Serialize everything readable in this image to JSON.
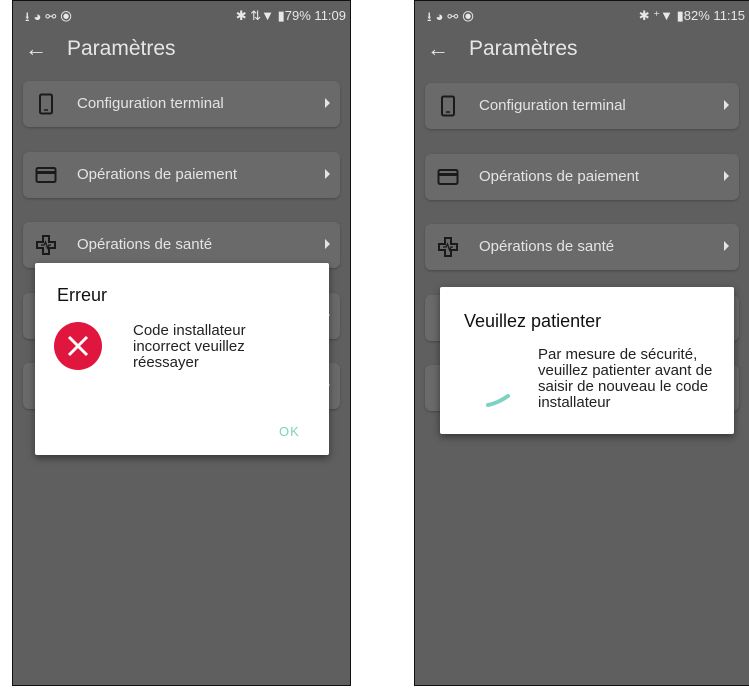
{
  "screens": [
    {
      "status": {
        "left_icons": "⭳◕⚯⦿",
        "right": "✱ ⇅▼ ▮79% 11:09"
      },
      "appbar": {
        "title": "Paramètres"
      },
      "menu": [
        {
          "label": "Configuration terminal",
          "icon": "phone-icon"
        },
        {
          "label": "Opérations de paiement",
          "icon": "card-icon"
        },
        {
          "label": "Opérations de santé",
          "icon": "health-cross-icon"
        }
      ],
      "dialog": {
        "title": "Erreur",
        "message": "Code installateur incorrect veuillez réessayer",
        "button": "OK",
        "icon": "error-x-icon",
        "icon_color": "#e0163e",
        "button_color": "#7dd3c0"
      }
    },
    {
      "status": {
        "left_icons": "⭳◕⚯⦿",
        "right": "✱ ⁺▼ ▮82% 11:15"
      },
      "appbar": {
        "title": "Paramètres"
      },
      "menu": [
        {
          "label": "Configuration terminal",
          "icon": "phone-icon"
        },
        {
          "label": "Opérations de paiement",
          "icon": "card-icon"
        },
        {
          "label": "Opérations de santé",
          "icon": "health-cross-icon"
        }
      ],
      "dialog": {
        "title": "Veuillez patienter",
        "message": "Par mesure de sécurité, veuillez patienter avant de saisir de nouveau le code installateur",
        "icon": "loading-spinner-icon",
        "spinner_color": "#7dd3c0"
      }
    }
  ]
}
